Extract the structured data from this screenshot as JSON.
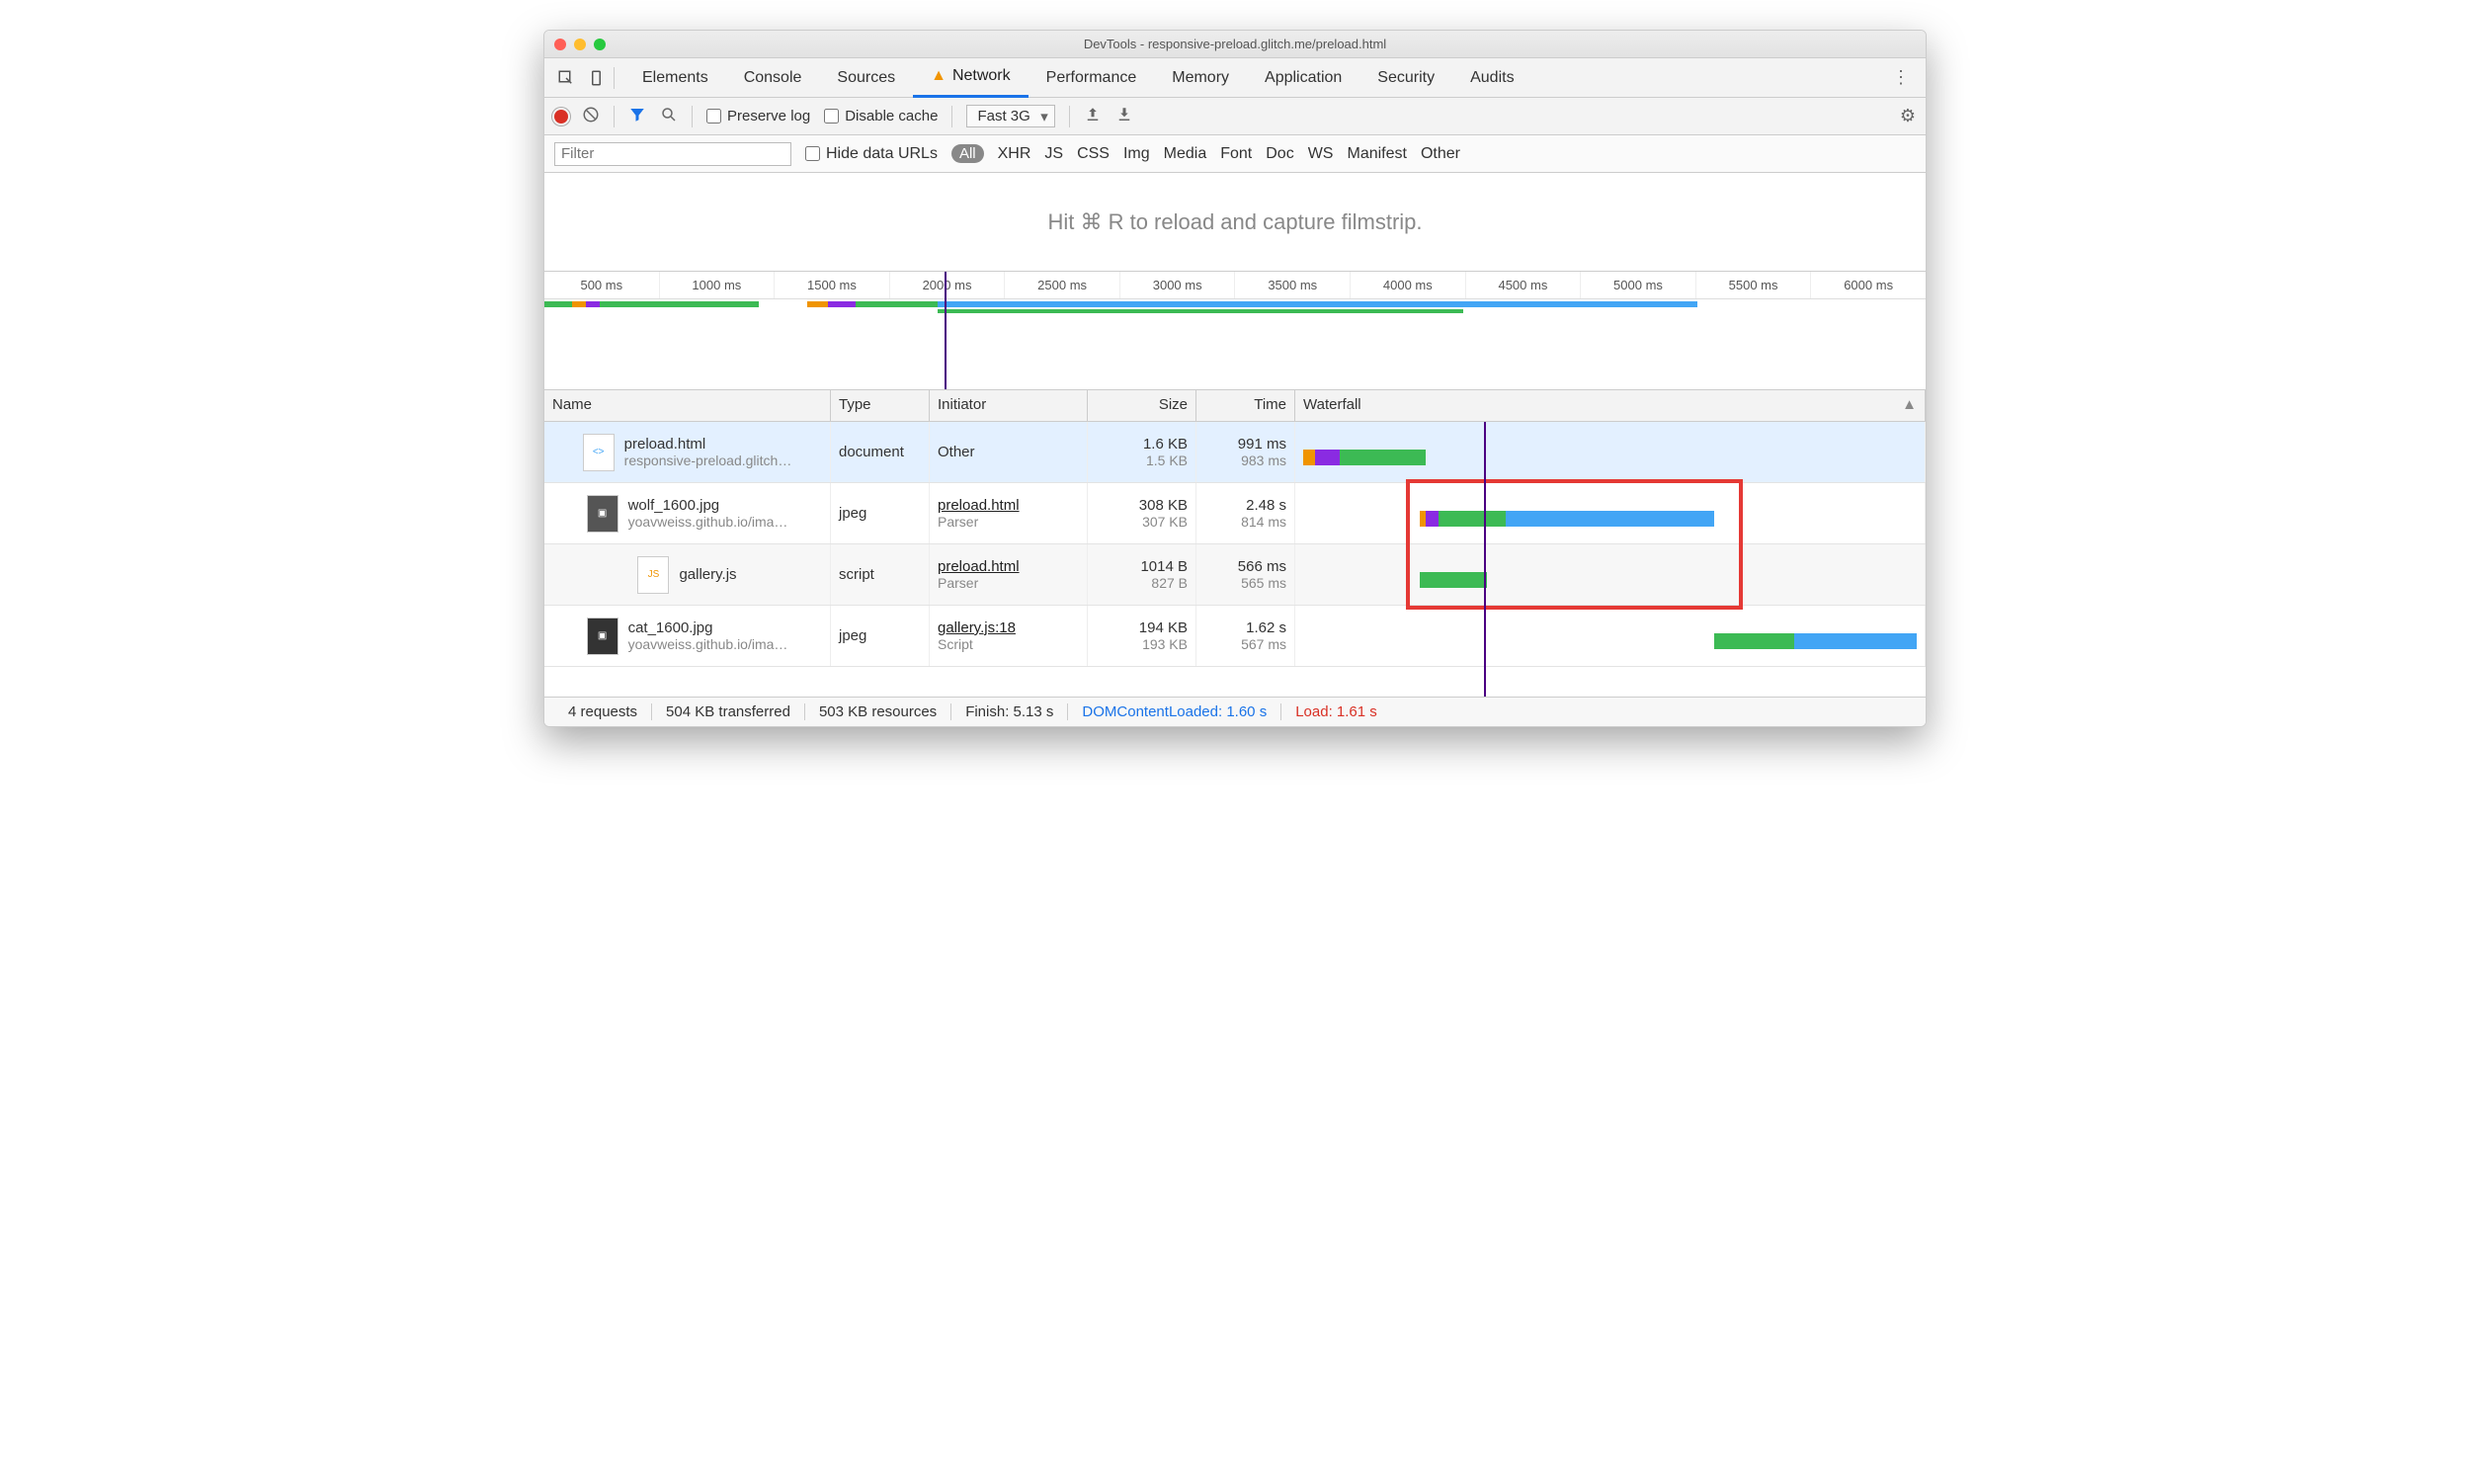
{
  "window": {
    "title": "DevTools - responsive-preload.glitch.me/preload.html"
  },
  "tabs": [
    "Elements",
    "Console",
    "Sources",
    "Network",
    "Performance",
    "Memory",
    "Application",
    "Security",
    "Audits"
  ],
  "active_tab": "Network",
  "toolbar": {
    "preserve_log": "Preserve log",
    "disable_cache": "Disable cache",
    "throttle": "Fast 3G"
  },
  "filterbar": {
    "placeholder": "Filter",
    "hide_data_urls": "Hide data URLs",
    "types": [
      "All",
      "XHR",
      "JS",
      "CSS",
      "Img",
      "Media",
      "Font",
      "Doc",
      "WS",
      "Manifest",
      "Other"
    ]
  },
  "filmstrip_hint": "Hit ⌘ R to reload and capture filmstrip.",
  "timeline_ticks": [
    "500 ms",
    "1000 ms",
    "1500 ms",
    "2000 ms",
    "2500 ms",
    "3000 ms",
    "3500 ms",
    "4000 ms",
    "4500 ms",
    "5000 ms",
    "5500 ms",
    "6000 ms"
  ],
  "columns": {
    "name": "Name",
    "type": "Type",
    "initiator": "Initiator",
    "size": "Size",
    "time": "Time",
    "waterfall": "Waterfall"
  },
  "rows": [
    {
      "name": "preload.html",
      "sub": "responsive-preload.glitch…",
      "type": "document",
      "initiator": "Other",
      "initiator_sub": "",
      "size": "1.6 KB",
      "size_sub": "1.5 KB",
      "time": "991 ms",
      "time_sub": "983 ms",
      "thumb": "<>"
    },
    {
      "name": "wolf_1600.jpg",
      "sub": "yoavweiss.github.io/ima…",
      "type": "jpeg",
      "initiator": "preload.html",
      "initiator_sub": "Parser",
      "size": "308 KB",
      "size_sub": "307 KB",
      "time": "2.48 s",
      "time_sub": "814 ms",
      "thumb": "img"
    },
    {
      "name": "gallery.js",
      "sub": "",
      "type": "script",
      "initiator": "preload.html",
      "initiator_sub": "Parser",
      "size": "1014 B",
      "size_sub": "827 B",
      "time": "566 ms",
      "time_sub": "565 ms",
      "thumb": "JS"
    },
    {
      "name": "cat_1600.jpg",
      "sub": "yoavweiss.github.io/ima…",
      "type": "jpeg",
      "initiator": "gallery.js:18",
      "initiator_sub": "Script",
      "size": "194 KB",
      "size_sub": "193 KB",
      "time": "1.62 s",
      "time_sub": "567 ms",
      "thumb": "img"
    }
  ],
  "status": {
    "requests": "4 requests",
    "transferred": "504 KB transferred",
    "resources": "503 KB resources",
    "finish": "Finish: 5.13 s",
    "dcl": "DOMContentLoaded: 1.60 s",
    "load": "Load: 1.61 s"
  }
}
